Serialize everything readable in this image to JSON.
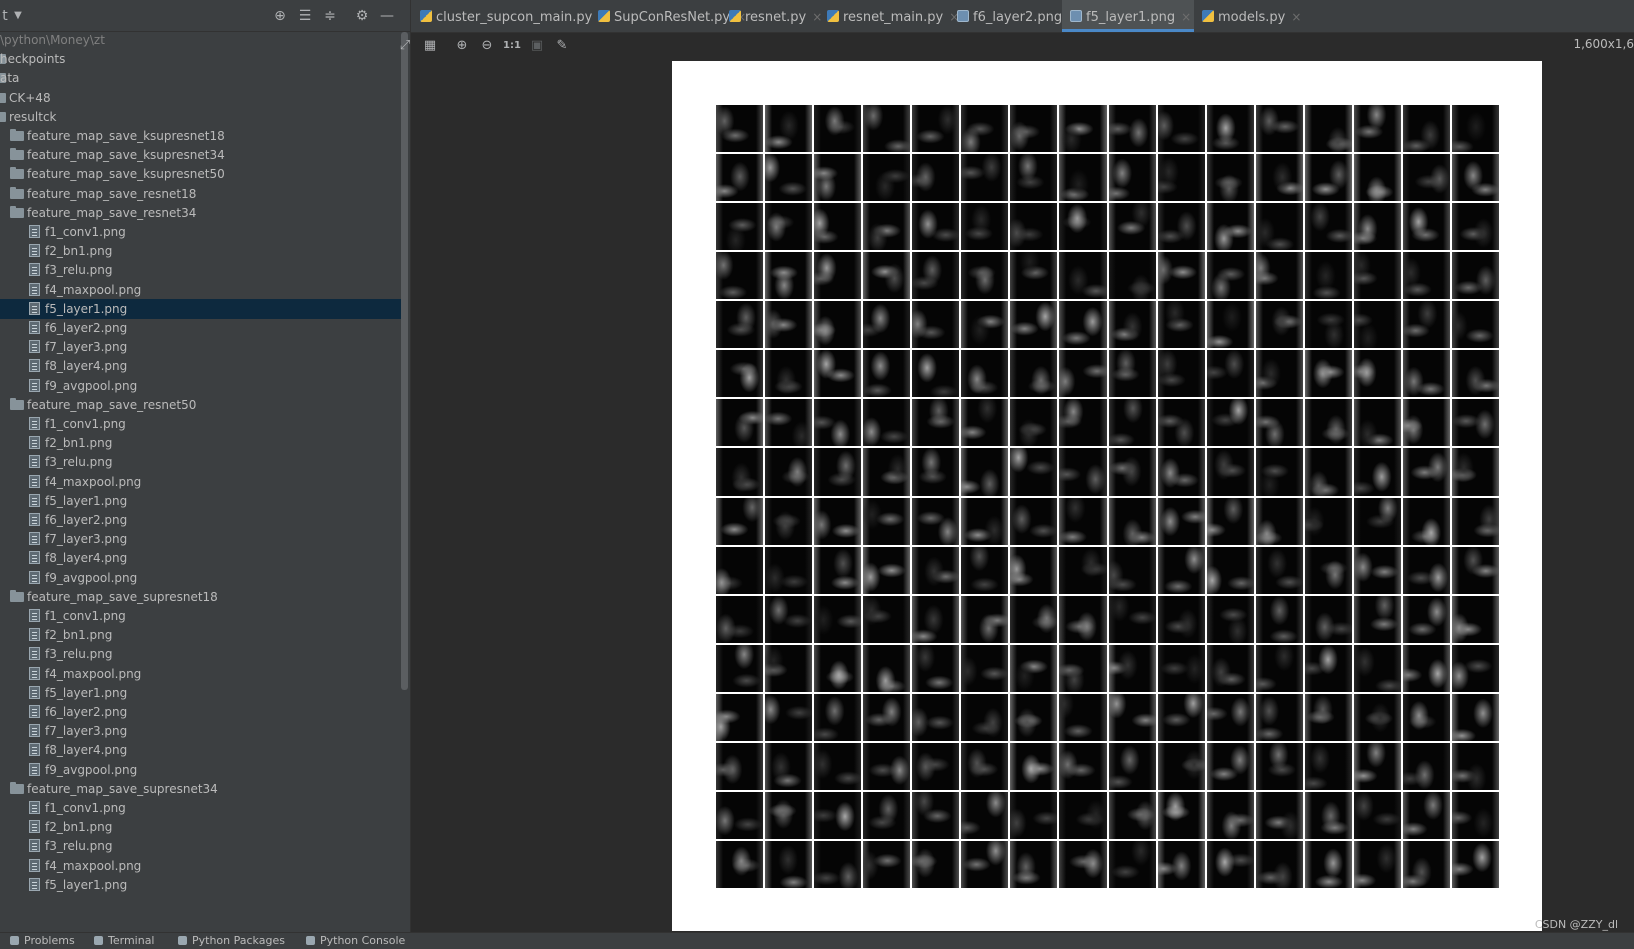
{
  "project_panel": {
    "toolbar_icons": [
      "dropdown-icon",
      "target-icon",
      "expand-all-icon",
      "collapse-all-icon",
      "gear-icon",
      "minimize-icon"
    ],
    "dropdown_label": "t",
    "rows": [
      {
        "label": "\\python\\Money\\zt",
        "kind": "path",
        "level": 0
      },
      {
        "label": "heckpoints",
        "kind": "folder-cut",
        "level": 0
      },
      {
        "label": "ata",
        "kind": "folder-cut",
        "level": 0
      },
      {
        "label": "CK+48",
        "kind": "folder-cut",
        "level": 0
      },
      {
        "label": "resultck",
        "kind": "folder-cut",
        "level": 0
      },
      {
        "label": "feature_map_save_ksupresnet18",
        "kind": "folder",
        "level": 1
      },
      {
        "label": "feature_map_save_ksupresnet34",
        "kind": "folder",
        "level": 1
      },
      {
        "label": "feature_map_save_ksupresnet50",
        "kind": "folder",
        "level": 1
      },
      {
        "label": "feature_map_save_resnet18",
        "kind": "folder",
        "level": 1
      },
      {
        "label": "feature_map_save_resnet34",
        "kind": "folder",
        "level": 1
      },
      {
        "label": "f1_conv1.png",
        "kind": "file",
        "level": 2
      },
      {
        "label": "f2_bn1.png",
        "kind": "file",
        "level": 2
      },
      {
        "label": "f3_relu.png",
        "kind": "file",
        "level": 2
      },
      {
        "label": "f4_maxpool.png",
        "kind": "file",
        "level": 2
      },
      {
        "label": "f5_layer1.png",
        "kind": "file",
        "level": 2,
        "selected": true
      },
      {
        "label": "f6_layer2.png",
        "kind": "file",
        "level": 2
      },
      {
        "label": "f7_layer3.png",
        "kind": "file",
        "level": 2
      },
      {
        "label": "f8_layer4.png",
        "kind": "file",
        "level": 2
      },
      {
        "label": "f9_avgpool.png",
        "kind": "file",
        "level": 2
      },
      {
        "label": "feature_map_save_resnet50",
        "kind": "folder",
        "level": 1
      },
      {
        "label": "f1_conv1.png",
        "kind": "file",
        "level": 2
      },
      {
        "label": "f2_bn1.png",
        "kind": "file",
        "level": 2
      },
      {
        "label": "f3_relu.png",
        "kind": "file",
        "level": 2
      },
      {
        "label": "f4_maxpool.png",
        "kind": "file",
        "level": 2
      },
      {
        "label": "f5_layer1.png",
        "kind": "file",
        "level": 2
      },
      {
        "label": "f6_layer2.png",
        "kind": "file",
        "level": 2
      },
      {
        "label": "f7_layer3.png",
        "kind": "file",
        "level": 2
      },
      {
        "label": "f8_layer4.png",
        "kind": "file",
        "level": 2
      },
      {
        "label": "f9_avgpool.png",
        "kind": "file",
        "level": 2
      },
      {
        "label": "feature_map_save_supresnet18",
        "kind": "folder",
        "level": 1
      },
      {
        "label": "f1_conv1.png",
        "kind": "file",
        "level": 2
      },
      {
        "label": "f2_bn1.png",
        "kind": "file",
        "level": 2
      },
      {
        "label": "f3_relu.png",
        "kind": "file",
        "level": 2
      },
      {
        "label": "f4_maxpool.png",
        "kind": "file",
        "level": 2
      },
      {
        "label": "f5_layer1.png",
        "kind": "file",
        "level": 2
      },
      {
        "label": "f6_layer2.png",
        "kind": "file",
        "level": 2
      },
      {
        "label": "f7_layer3.png",
        "kind": "file",
        "level": 2
      },
      {
        "label": "f8_layer4.png",
        "kind": "file",
        "level": 2
      },
      {
        "label": "f9_avgpool.png",
        "kind": "file",
        "level": 2
      },
      {
        "label": "feature_map_save_supresnet34",
        "kind": "folder",
        "level": 1
      },
      {
        "label": "f1_conv1.png",
        "kind": "file",
        "level": 2
      },
      {
        "label": "f2_bn1.png",
        "kind": "file",
        "level": 2
      },
      {
        "label": "f3_relu.png",
        "kind": "file",
        "level": 2
      },
      {
        "label": "f4_maxpool.png",
        "kind": "file",
        "level": 2
      },
      {
        "label": "f5_layer1.png",
        "kind": "file",
        "level": 2
      }
    ]
  },
  "tabs": [
    {
      "label": "cluster_supcon_main.py",
      "type": "py",
      "active": false
    },
    {
      "label": "SupConResNet.py",
      "type": "py",
      "active": false
    },
    {
      "label": "resnet.py",
      "type": "py",
      "active": false
    },
    {
      "label": "resnet_main.py",
      "type": "py",
      "active": false
    },
    {
      "label": "f6_layer2.png",
      "type": "img",
      "active": false
    },
    {
      "label": "f5_layer1.png",
      "type": "img",
      "active": true
    },
    {
      "label": "models.py",
      "type": "py",
      "active": false
    }
  ],
  "viewer": {
    "toolbar_icons": [
      "fit-icon",
      "grid-icon",
      "zoom-in-icon",
      "zoom-out-icon",
      "actual-size-icon",
      "background-icon",
      "color-picker-icon"
    ],
    "actual_size_label": "1:1",
    "image_info": "1,600x1,6",
    "grid_rows": 16,
    "grid_cols": 16
  },
  "bottom_tabs": [
    {
      "label": "Problems"
    },
    {
      "label": "Terminal"
    },
    {
      "label": "Python Packages"
    },
    {
      "label": "Python Console"
    }
  ],
  "watermark": "CSDN @ZZY_dl"
}
